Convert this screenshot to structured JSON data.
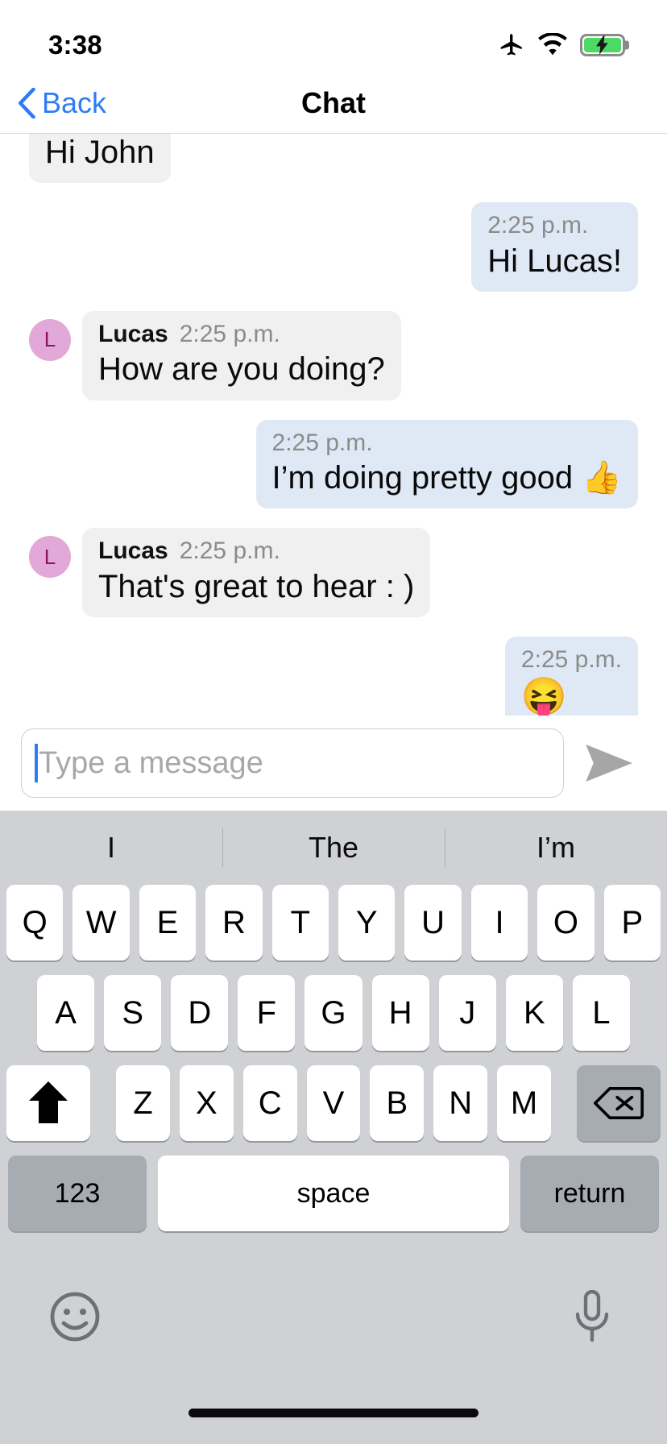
{
  "status_bar": {
    "time": "3:38",
    "icons": [
      "airplane-mode-icon",
      "wifi-icon",
      "battery-charging-icon"
    ]
  },
  "nav_bar": {
    "back_label": "Back",
    "title": "Chat",
    "back_icon": "chevron-left-icon",
    "accent_color": "#2d7cf6"
  },
  "conversation": {
    "messages": [
      {
        "direction": "in",
        "sender": "",
        "time": "",
        "text": "Hi John",
        "clipped": true,
        "show_avatar": false
      },
      {
        "direction": "out",
        "sender": "",
        "time": "2:25 p.m.",
        "text": "Hi Lucas!",
        "clipped": false,
        "show_avatar": false
      },
      {
        "direction": "in",
        "sender": "Lucas",
        "time": "2:25 p.m.",
        "text": "How are you doing?",
        "clipped": false,
        "show_avatar": true,
        "avatar_letter": "L"
      },
      {
        "direction": "out",
        "sender": "",
        "time": "2:25 p.m.",
        "text": "I’m doing pretty good 👍",
        "clipped": false,
        "show_avatar": false
      },
      {
        "direction": "in",
        "sender": "Lucas",
        "time": "2:25 p.m.",
        "text": "That's great to hear : )",
        "clipped": false,
        "show_avatar": true,
        "avatar_letter": "L"
      },
      {
        "direction": "out",
        "sender": "",
        "time": "2:25 p.m.",
        "text": "😝",
        "clipped": false,
        "show_avatar": false,
        "emoji_only": true
      }
    ],
    "bubble_colors": {
      "incoming": "#f0f0f0",
      "outgoing": "#dfe9f5",
      "avatar_bg": "#e2a8d8",
      "avatar_fg": "#8a1461"
    }
  },
  "composer": {
    "placeholder": "Type a message",
    "value": "",
    "send_icon": "send-arrow-icon"
  },
  "keyboard": {
    "suggestions": [
      "I",
      "The",
      "I’m"
    ],
    "row1": [
      "Q",
      "W",
      "E",
      "R",
      "T",
      "Y",
      "U",
      "I",
      "O",
      "P"
    ],
    "row2": [
      "A",
      "S",
      "D",
      "F",
      "G",
      "H",
      "J",
      "K",
      "L"
    ],
    "row3": [
      "Z",
      "X",
      "C",
      "V",
      "B",
      "N",
      "M"
    ],
    "shift_icon": "shift-arrow-icon",
    "backspace_icon": "backspace-icon",
    "numbers_label": "123",
    "space_label": "space",
    "return_label": "return",
    "emoji_icon": "emoji-face-icon",
    "mic_icon": "microphone-icon",
    "background_color": "#cfd1d5",
    "key_color": "#ffffff",
    "modifier_key_color": "#a7abb2"
  }
}
